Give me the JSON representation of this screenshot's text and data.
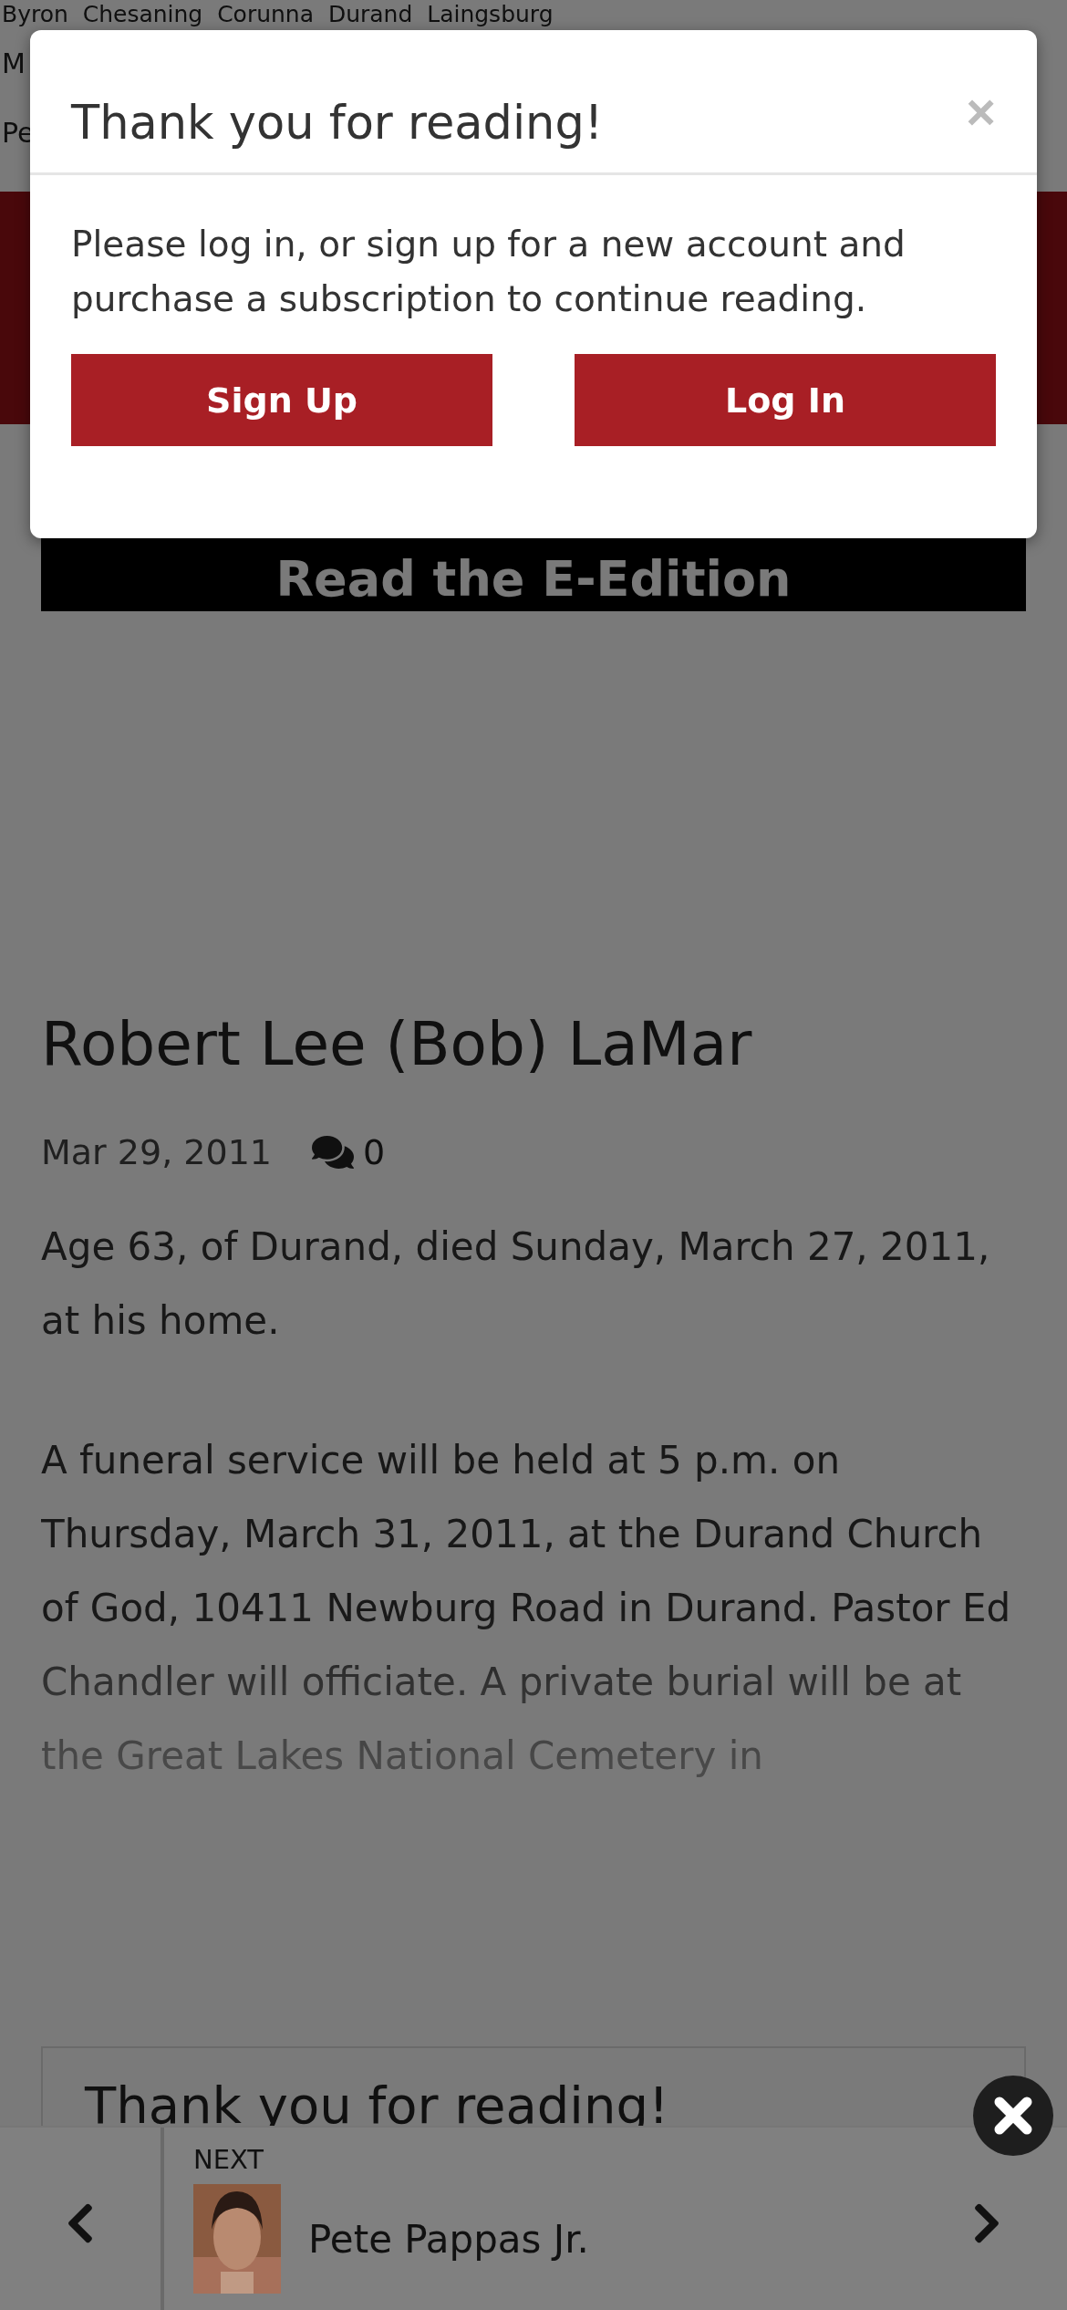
{
  "page": {
    "towns_line": "Byron  Chesaning  Corunna  Durand  Laingsburg",
    "cut_lines": [
      "M",
      "Pe"
    ],
    "eedition_button": "Read the E-Edition",
    "article": {
      "title": "Robert Lee (Bob) LaMar",
      "date": "Mar 29, 2011",
      "comment_count": "0",
      "paragraphs": [
        "Age 63, of Durand, died Sunday, March 27, 2011, at his home.",
        "A funeral service will be held at 5 p.m. on Thursday, March 31, 2011, at the Durand Church of God, 10411 Newburg Road in Durand. Pastor Ed Chandler will officiate. A private burial will be at the Great Lakes National Cemetery in"
      ]
    },
    "paywall_card": {
      "title": "Thank you for reading!"
    },
    "next_bar": {
      "label": "NEXT",
      "title": "Pete Pappas Jr."
    }
  },
  "modal": {
    "title": "Thank you for reading!",
    "close": "×",
    "message": "Please log in, or sign up for a new account and purchase a subscription to continue reading.",
    "buttons": [
      "Sign Up",
      "Log In"
    ]
  }
}
